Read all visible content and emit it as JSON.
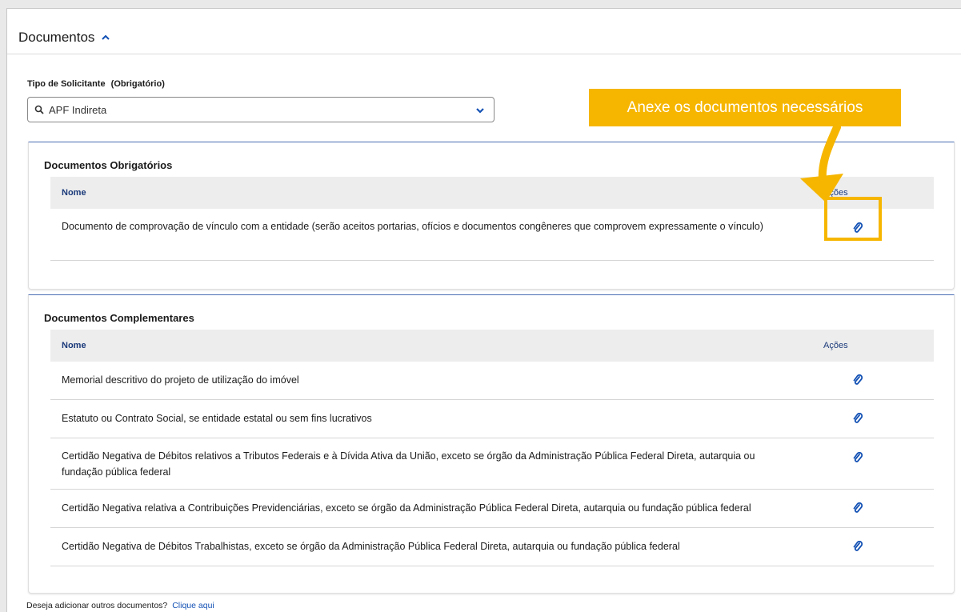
{
  "section": {
    "title": "Documentos"
  },
  "field": {
    "label": "Tipo de Solicitante",
    "required": "(Obrigatório)",
    "value": "APF Indireta"
  },
  "obrigatorios": {
    "title": "Documentos Obrigatórios",
    "col_name": "Nome",
    "col_actions": "Ações",
    "rows": [
      "Documento de comprovação de vínculo com a entidade (serão aceitos portarias, ofícios e documentos congêneres que comprovem expressamente o vínculo)"
    ]
  },
  "complementares": {
    "title": "Documentos Complementares",
    "col_name": "Nome",
    "col_actions": "Ações",
    "rows": [
      "Memorial descritivo do projeto de utilização do imóvel",
      "Estatuto ou Contrato Social, se entidade estatal ou sem fins lucrativos",
      "Certidão Negativa de Débitos relativos a Tributos Federais e à Dívida Ativa da União, exceto se órgão da Administração Pública Federal Direta, autarquia ou fundação pública federal",
      "Certidão Negativa relativa a Contribuições Previdenciárias, exceto se órgão da Administração Pública Federal Direta, autarquia ou fundação pública federal",
      "Certidão Negativa de Débitos Trabalhistas, exceto se órgão da Administração Pública Federal Direta, autarquia ou fundação pública federal"
    ]
  },
  "footer": {
    "question": "Deseja adicionar outros documentos?",
    "link": "Clique aqui"
  },
  "callout": {
    "text": "Anexe os documentos necessários"
  },
  "colors": {
    "accent": "#1351b4",
    "callout": "#f6b600",
    "table_header_bg": "#ededed"
  },
  "icons": [
    "chevron-up-icon",
    "search-icon",
    "chevron-down-icon",
    "paperclip-icon"
  ]
}
